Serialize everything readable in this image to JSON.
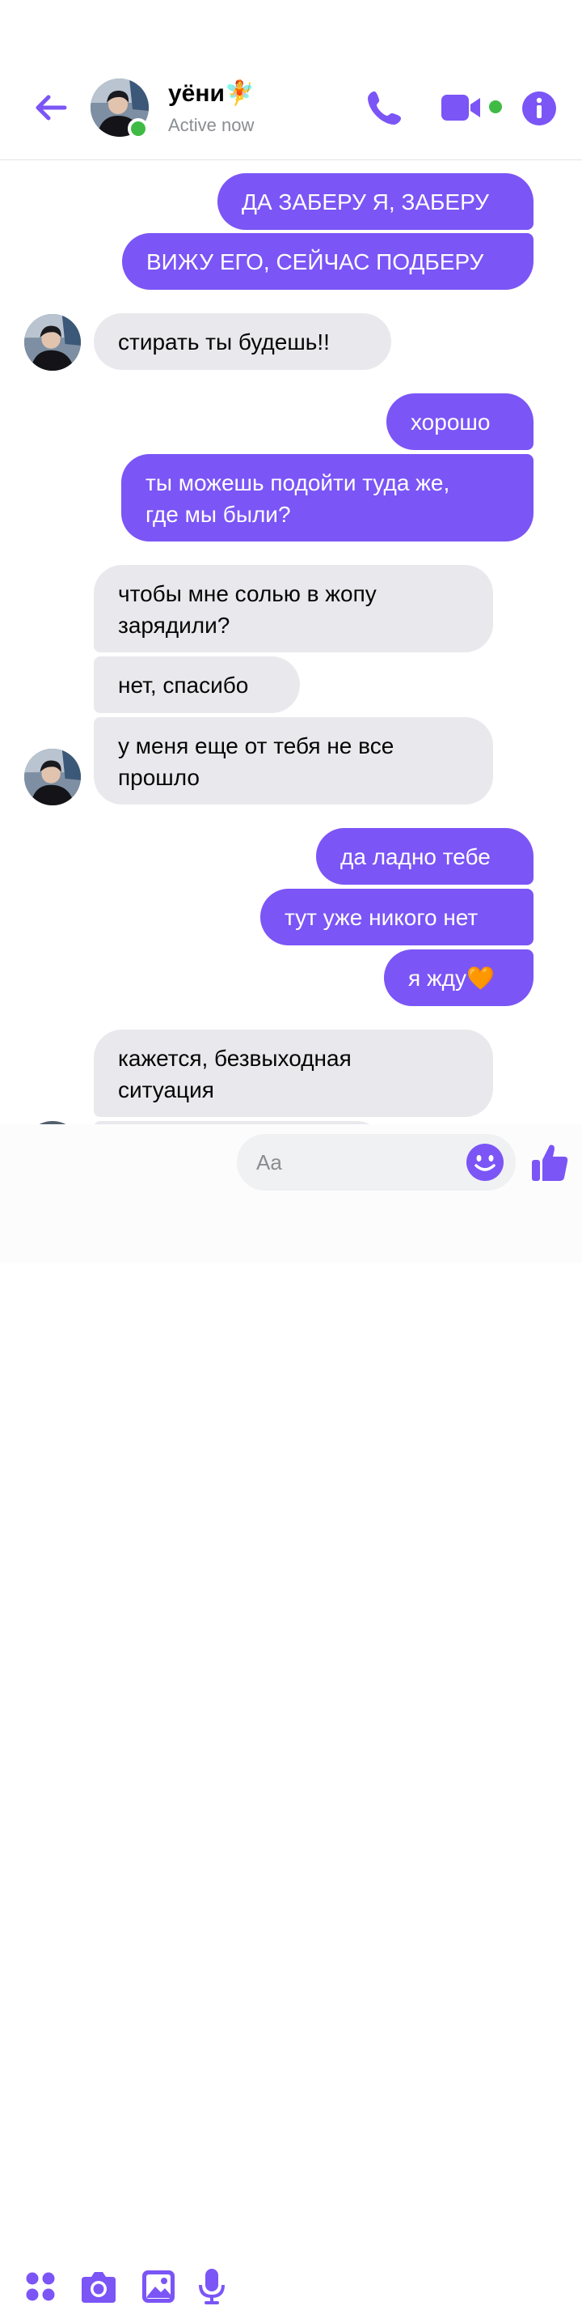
{
  "header": {
    "contact_name": "уёни🧚",
    "status": "Active now",
    "icons": {
      "back": "back-arrow-icon",
      "call": "phone-icon",
      "video": "video-call-icon",
      "info": "info-icon"
    }
  },
  "colors": {
    "accent": "#7b55f6",
    "incoming_bubble": "#e9e8ec",
    "online": "#3fbb45"
  },
  "messages": [
    {
      "dir": "out",
      "text": "ДА ЗАБЕРУ Я, ЗАБЕРУ"
    },
    {
      "dir": "out",
      "text": "ВИЖУ ЕГО, СЕЙЧАС ПОДБЕРУ"
    },
    {
      "dir": "in",
      "text": "стирать ты будешь!!"
    },
    {
      "dir": "out",
      "text": "хорошо"
    },
    {
      "dir": "out",
      "text": "ты можешь подойти туда же,\nгде мы были?"
    },
    {
      "dir": "in",
      "text": "чтобы мне солью в жопу\nзарядили?"
    },
    {
      "dir": "in",
      "text": "нет, спасибо"
    },
    {
      "dir": "in",
      "text": "у меня еще от тебя не все\nпрошло"
    },
    {
      "dir": "out",
      "text": "да ладно тебе"
    },
    {
      "dir": "out",
      "text": "тут уже никого нет"
    },
    {
      "dir": "out",
      "text": "я жду🧡"
    },
    {
      "dir": "in",
      "text": "кажется, безвыходная\nситуация"
    }
  ],
  "composer": {
    "placeholder": "Aa",
    "icons": [
      "apps-icon",
      "camera-icon",
      "gallery-icon",
      "microphone-icon",
      "emoji-icon",
      "like-icon"
    ]
  }
}
